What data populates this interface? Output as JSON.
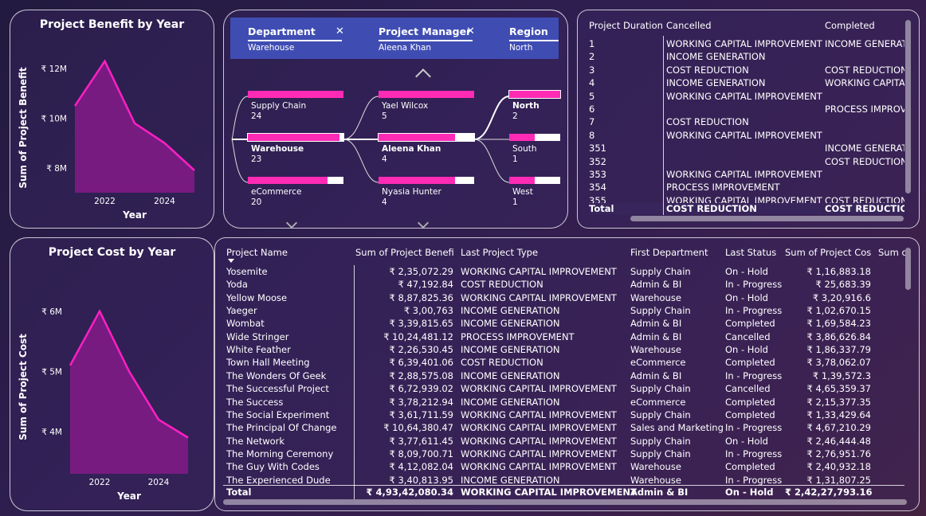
{
  "benefit_chart": {
    "title": "Project Benefit by Year",
    "xlabel": "Year",
    "ylabel": "Sum of Project Benefit",
    "x_ticks": [
      "2022",
      "2024"
    ],
    "y_ticks": [
      "₹ 12M",
      "₹ 10M",
      "₹ 8M"
    ]
  },
  "cost_chart": {
    "title": "Project Cost by Year",
    "xlabel": "Year",
    "ylabel": "Sum of Project Cost",
    "x_ticks": [
      "2022",
      "2024"
    ],
    "y_ticks": [
      "₹ 6M",
      "₹ 5M",
      "₹ 4M"
    ]
  },
  "chart_data": [
    {
      "type": "area",
      "title": "Project Benefit by Year",
      "xlabel": "Year",
      "ylabel": "Sum of Project Benefit",
      "x": [
        2021,
        2022,
        2023,
        2024,
        2025
      ],
      "values": [
        10.5,
        12.3,
        9.8,
        9.0,
        7.9
      ],
      "ylim": [
        7.0,
        13.0
      ],
      "unit": "₹ M",
      "color": "#ff1fc4"
    },
    {
      "type": "area",
      "title": "Project Cost by Year",
      "xlabel": "Year",
      "ylabel": "Sum of Project Cost",
      "x": [
        2021,
        2022,
        2023,
        2024,
        2025
      ],
      "values": [
        5.1,
        6.0,
        5.0,
        4.2,
        3.9
      ],
      "ylim": [
        3.3,
        6.5
      ],
      "unit": "₹ M",
      "color": "#ff1fc4"
    }
  ],
  "tree": {
    "columns": [
      {
        "label": "Department",
        "value": "Warehouse"
      },
      {
        "label": "Project Manager",
        "value": "Aleena Khan"
      },
      {
        "label": "Region",
        "value": "North"
      }
    ],
    "departments": [
      {
        "name": "Supply Chain",
        "count": "24",
        "fill": 1.0
      },
      {
        "name": "Warehouse",
        "count": "23",
        "fill": 0.96
      },
      {
        "name": "eCommerce",
        "count": "20",
        "fill": 0.83
      }
    ],
    "managers": [
      {
        "name": "Yael Wilcox",
        "count": "5",
        "fill": 1.0
      },
      {
        "name": "Aleena Khan",
        "count": "4",
        "fill": 0.8
      },
      {
        "name": "Nyasia Hunter",
        "count": "4",
        "fill": 0.8
      }
    ],
    "regions": [
      {
        "name": "North",
        "count": "2",
        "fill": 1.0
      },
      {
        "name": "South",
        "count": "1",
        "fill": 0.5
      },
      {
        "name": "West",
        "count": "1",
        "fill": 0.5
      }
    ]
  },
  "matrix": {
    "headers": [
      "Project Duration",
      "Cancelled",
      "Completed"
    ],
    "rows": [
      [
        "1",
        "WORKING CAPITAL IMPROVEMENT",
        "INCOME GENERAT"
      ],
      [
        "2",
        "INCOME GENERATION",
        ""
      ],
      [
        "3",
        "COST REDUCTION",
        "COST REDUCTION"
      ],
      [
        "4",
        "INCOME GENERATION",
        "WORKING CAPITAI"
      ],
      [
        "5",
        "WORKING CAPITAL IMPROVEMENT",
        ""
      ],
      [
        "6",
        "",
        "PROCESS IMPROVI"
      ],
      [
        "7",
        "COST REDUCTION",
        ""
      ],
      [
        "8",
        "WORKING CAPITAL IMPROVEMENT",
        ""
      ],
      [
        "351",
        "",
        "INCOME GENERAT"
      ],
      [
        "352",
        "",
        "COST REDUCTION"
      ],
      [
        "353",
        "WORKING CAPITAL IMPROVEMENT",
        ""
      ],
      [
        "354",
        "PROCESS IMPROVEMENT",
        ""
      ],
      [
        "355",
        "WORKING CAPITAL IMPROVEMENT",
        "COST REDUCTION"
      ]
    ],
    "total": [
      "Total",
      "COST REDUCTION",
      "COST REDUCTION"
    ]
  },
  "table": {
    "headers": [
      "Project Name",
      "Sum of Project Benefit",
      "Last Project Type",
      "First Department",
      "Last Status",
      "Sum of Project Cost",
      "Sum o"
    ],
    "rows": [
      [
        "Yosemite",
        "₹ 2,35,072.29",
        "WORKING CAPITAL IMPROVEMENT",
        "Supply Chain",
        "On - Hold",
        "₹ 1,16,883.18"
      ],
      [
        "Yoda",
        "₹ 47,192.84",
        "COST REDUCTION",
        "Admin & BI",
        "In - Progress",
        "₹ 25,683.39"
      ],
      [
        "Yellow Moose",
        "₹ 8,87,825.36",
        "WORKING CAPITAL IMPROVEMENT",
        "Warehouse",
        "On - Hold",
        "₹ 3,20,916.6"
      ],
      [
        "Yaeger",
        "₹ 3,00,763",
        "INCOME GENERATION",
        "Supply Chain",
        "In - Progress",
        "₹ 1,02,670.15"
      ],
      [
        "Wombat",
        "₹ 3,39,815.65",
        "INCOME GENERATION",
        "Admin & BI",
        "Completed",
        "₹ 1,69,584.23"
      ],
      [
        "Wide Stringer",
        "₹ 10,24,481.12",
        "PROCESS IMPROVEMENT",
        "Admin & BI",
        "Cancelled",
        "₹ 3,86,626.84"
      ],
      [
        "White Feather",
        "₹ 2,26,530.45",
        "INCOME GENERATION",
        "Warehouse",
        "On - Hold",
        "₹ 1,86,337.79"
      ],
      [
        "Town Hall Meeting",
        "₹ 6,39,401.06",
        "COST REDUCTION",
        "eCommerce",
        "Completed",
        "₹ 3,78,062.07"
      ],
      [
        "The Wonders Of Geek",
        "₹ 2,88,575.08",
        "INCOME GENERATION",
        "Admin & BI",
        "In - Progress",
        "₹ 1,39,572.3"
      ],
      [
        "The Successful Project",
        "₹ 6,72,939.02",
        "WORKING CAPITAL IMPROVEMENT",
        "Supply Chain",
        "Cancelled",
        "₹ 4,65,359.37"
      ],
      [
        "The Success",
        "₹ 3,78,212.94",
        "INCOME GENERATION",
        "eCommerce",
        "Completed",
        "₹ 2,15,377.35"
      ],
      [
        "The Social Experiment",
        "₹ 3,61,711.59",
        "WORKING CAPITAL IMPROVEMENT",
        "Supply Chain",
        "Completed",
        "₹ 1,33,429.64"
      ],
      [
        "The Principal Of Change",
        "₹ 10,64,380.47",
        "WORKING CAPITAL IMPROVEMENT",
        "Sales and Marketing",
        "In - Progress",
        "₹ 4,67,210.29"
      ],
      [
        "The Network",
        "₹ 3,77,611.45",
        "WORKING CAPITAL IMPROVEMENT",
        "Supply Chain",
        "On - Hold",
        "₹ 2,46,444.48"
      ],
      [
        "The Morning Ceremony",
        "₹ 8,09,700.71",
        "WORKING CAPITAL IMPROVEMENT",
        "Supply Chain",
        "In - Progress",
        "₹ 2,76,951.76"
      ],
      [
        "The Guy With Codes",
        "₹ 4,12,082.04",
        "WORKING CAPITAL IMPROVEMENT",
        "Warehouse",
        "Completed",
        "₹ 2,40,932.18"
      ],
      [
        "The Experienced Dude",
        "₹ 3,40,813.95",
        "INCOME GENERATION",
        "Warehouse",
        "In - Progress",
        "₹ 1,31,807.25"
      ]
    ],
    "total": [
      "Total",
      "₹ 4,93,42,080.34",
      "WORKING CAPITAL IMPROVEMENT",
      "Admin & BI",
      "On - Hold",
      "₹ 2,42,27,793.16"
    ]
  }
}
